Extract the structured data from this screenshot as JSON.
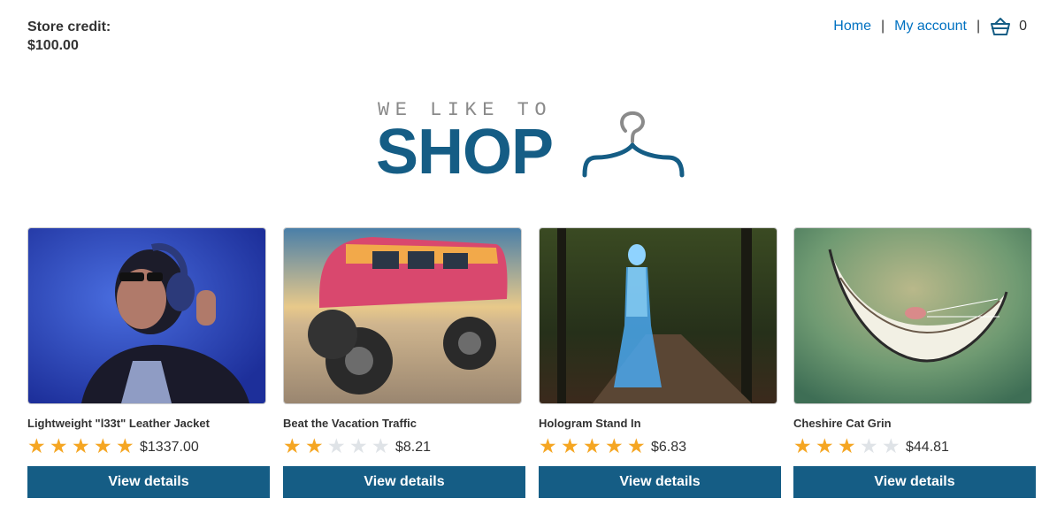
{
  "header": {
    "store_credit_label": "Store credit:",
    "store_credit_value": "$100.00",
    "nav": {
      "home": "Home",
      "separator": "|",
      "my_account": "My account"
    },
    "cart": {
      "icon": "basket-icon",
      "count": "0"
    }
  },
  "logo": {
    "tagline": "WE LIKE TO",
    "word": "SHOP",
    "icon": "hanger-icon"
  },
  "products": [
    {
      "title": "Lightweight \"l33t\" Leather Jacket",
      "rating": 5,
      "price": "$1337.00",
      "button": "View details",
      "image": "woman-headphones-image"
    },
    {
      "title": "Beat the Vacation Traffic",
      "rating": 2,
      "price": "$8.21",
      "button": "View details",
      "image": "monster-van-image"
    },
    {
      "title": "Hologram Stand In",
      "rating": 5,
      "price": "$6.83",
      "button": "View details",
      "image": "hologram-woman-image"
    },
    {
      "title": "Cheshire Cat Grin",
      "rating": 3,
      "price": "$44.81",
      "button": "View details",
      "image": "cat-grin-image"
    }
  ],
  "colors": {
    "brand": "#155d85",
    "link": "#0071c1",
    "star_on": "#f5a623",
    "star_off": "#dfe3e7"
  }
}
